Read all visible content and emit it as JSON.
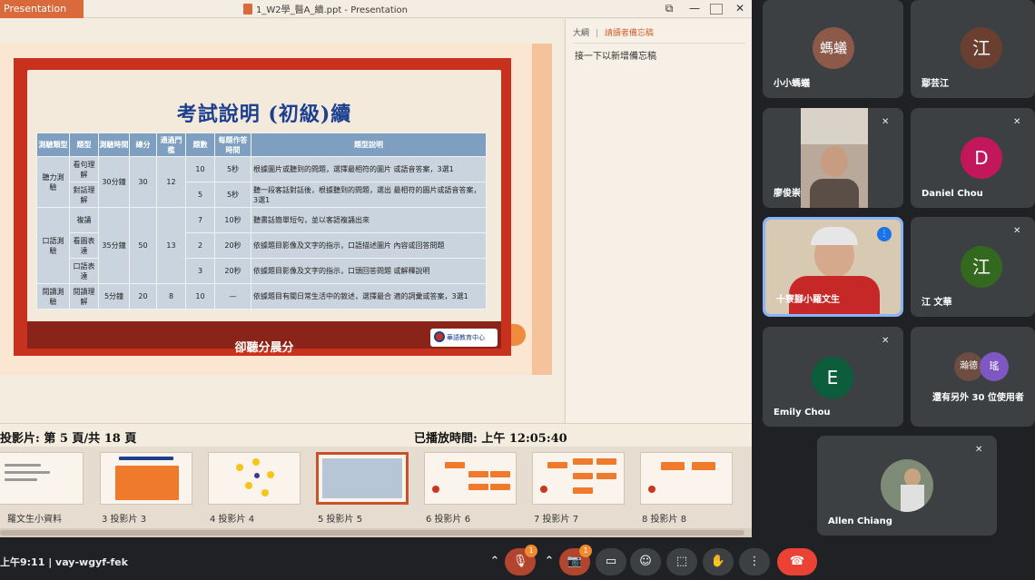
{
  "window": {
    "app_tab": "Presentation",
    "doc_title": "1_W2學_醫A_續.ppt - Presentation",
    "minimize": "—",
    "close": "✕"
  },
  "slide": {
    "title": "考試說明 (初級)續",
    "footer": "卻聽分晨分",
    "logo_text": "華語教育中心",
    "table": {
      "headers": [
        "測驗類型",
        "題型",
        "測驗時間",
        "總分",
        "通過門檻",
        "題數",
        "每題作答時間",
        "題型說明"
      ],
      "rows": [
        [
          "聽力測驗",
          "看句理解",
          "30分鐘",
          "30",
          "12",
          "10",
          "5秒",
          "根據圖片或聽到的問題，選擇最相符的圖片 或語音答案，3選1"
        ],
        [
          "",
          "對話理解",
          "",
          "",
          "",
          "5",
          "5秒",
          "聽一段客話對話後，根據聽到的問題，選出 最相符的圖片或語音答案，3選1"
        ],
        [
          "口語測驗",
          "複誦",
          "35分鐘",
          "50",
          "13",
          "7",
          "10秒",
          "聽書話簡單短句，並以客語複誦出來"
        ],
        [
          "",
          "看圖表達",
          "",
          "",
          "",
          "2",
          "20秒",
          "依據題目影像及文字的指示，口語描述圖片 內容或回答問題"
        ],
        [
          "",
          "口語表達",
          "",
          "",
          "",
          "3",
          "20秒",
          "依據題目影像及文字的指示，口頭回答問題 或解釋說明"
        ],
        [
          "閱讀測驗",
          "閱讀理解",
          "5分鐘",
          "20",
          "8",
          "10",
          "—",
          "依據題目有關日常生活中的敘述，選擇最合 適的詞彙或答案，3選1"
        ]
      ]
    }
  },
  "notes": {
    "tab_outline": "大綱",
    "tab_notes": "請讀者備忘稿",
    "body": "接一下以新增備忘稿"
  },
  "status": {
    "left": "投影片: 第 5 頁/共 18 頁",
    "right": "已播放時間: 上午 12:05:40"
  },
  "thumbnails": [
    {
      "label": "羅文生小資料"
    },
    {
      "label": "3  投影片 3"
    },
    {
      "label": "4  投影片 4"
    },
    {
      "label": "5  投影片 5"
    },
    {
      "label": "6  投影片 6"
    },
    {
      "label": "7  投影片 7"
    },
    {
      "label": "8  投影片 8"
    }
  ],
  "participants": {
    "p1": {
      "name": "小小螞蟻",
      "avatar": "螞蟻",
      "color": "#8d5a4a"
    },
    "p2": {
      "name": "鄢芸江",
      "avatar": "江",
      "color": "#6b3f2f"
    },
    "p3": {
      "name": "廖俊崇"
    },
    "p4": {
      "name": "Daniel Chou",
      "avatar": "D",
      "color": "#c2185b"
    },
    "p5": {
      "name": "十寮腳小羅文生"
    },
    "p6": {
      "name": "江 文華",
      "avatar": "江",
      "color": "#33691e"
    },
    "p7": {
      "name": "Emily Chou",
      "avatar": "E",
      "color": "#0b5d3b"
    },
    "p8": {
      "name": "還有另外 30 位使用者",
      "avatar_a": "瀚德",
      "avatar_b": "瑤",
      "color_a": "#6d4c41",
      "color_b": "#7e57c2"
    },
    "p9": {
      "name": "Allen Chiang"
    }
  },
  "bottom": {
    "clock": "上午9:11  |  vay-wgyf-fek",
    "badge_count": "1",
    "icons": [
      "chevron-up",
      "mic",
      "chevron-up",
      "camera",
      "captions",
      "emoji",
      "present",
      "hand",
      "more",
      "end-call"
    ]
  }
}
